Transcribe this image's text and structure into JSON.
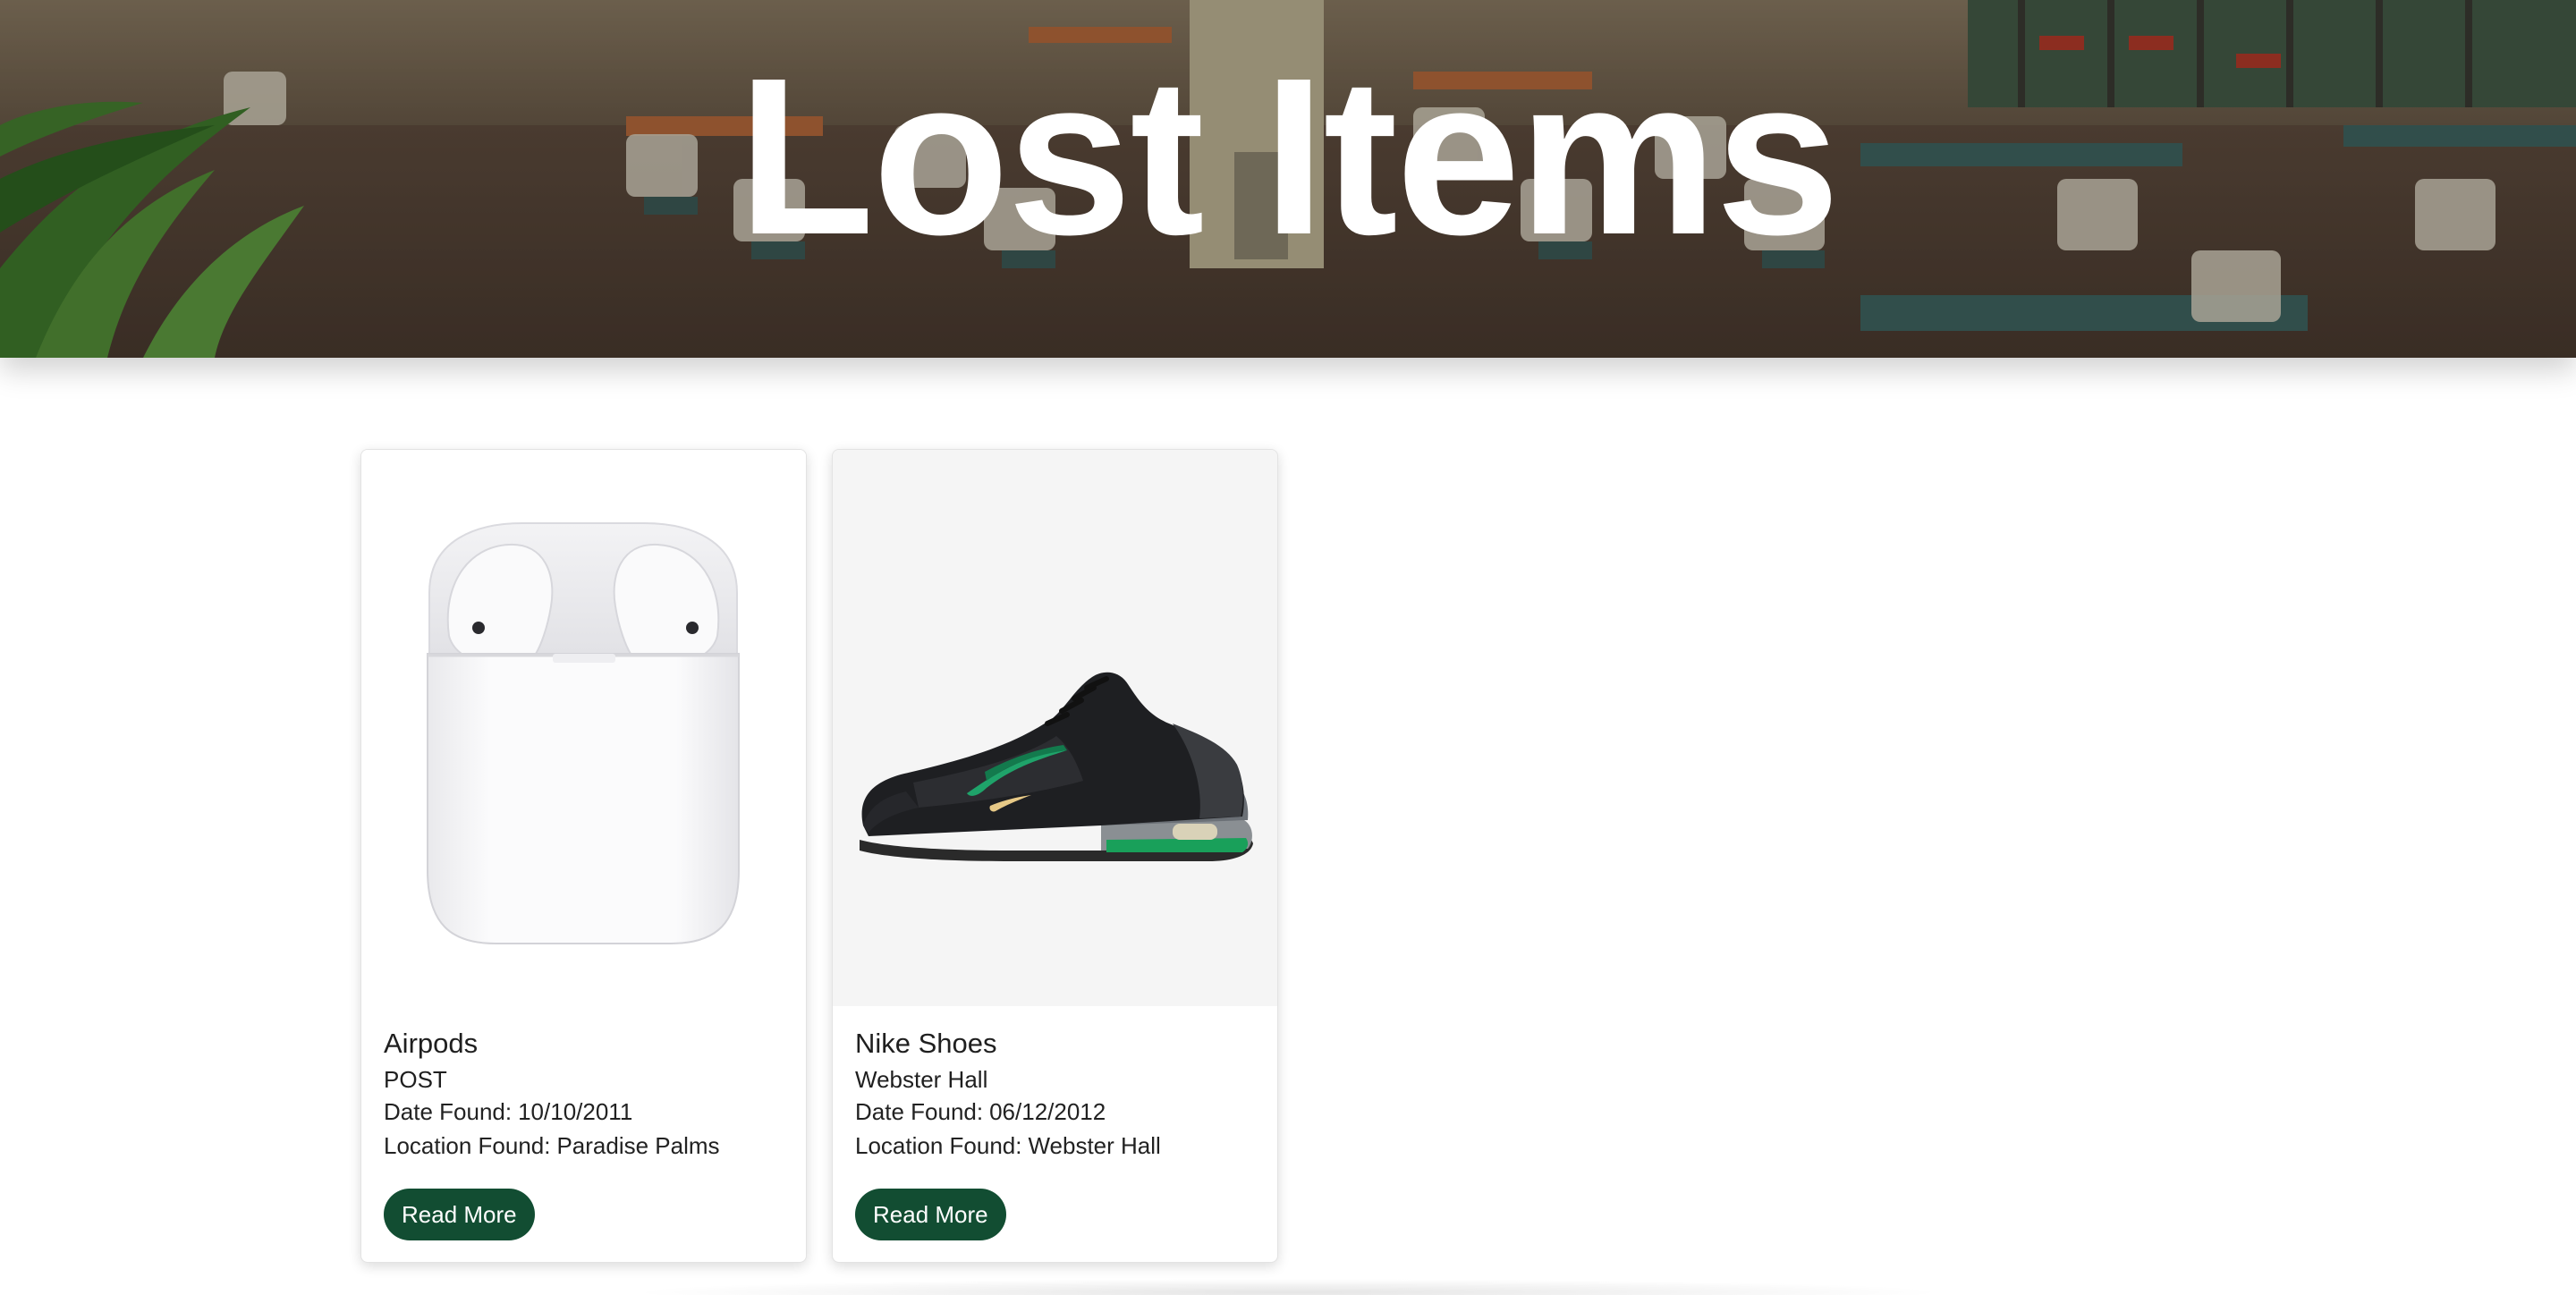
{
  "hero": {
    "title": "Lost Items"
  },
  "items": [
    {
      "name": "Airpods",
      "subtitle": "POST",
      "date_label": "Date Found:",
      "date_value": "10/10/2011",
      "location_label": "Location Found:",
      "location_value": "Paradise Palms",
      "button_label": "Read More",
      "image_icon": "airpods-case-icon"
    },
    {
      "name": "Nike Shoes",
      "subtitle": "Webster Hall",
      "date_label": "Date Found:",
      "date_value": "06/12/2012",
      "location_label": "Location Found:",
      "location_value": "Webster Hall",
      "button_label": "Read More",
      "image_icon": "sneaker-icon"
    }
  ],
  "colors": {
    "button_bg": "#124d32",
    "hero_text": "#ffffff"
  }
}
